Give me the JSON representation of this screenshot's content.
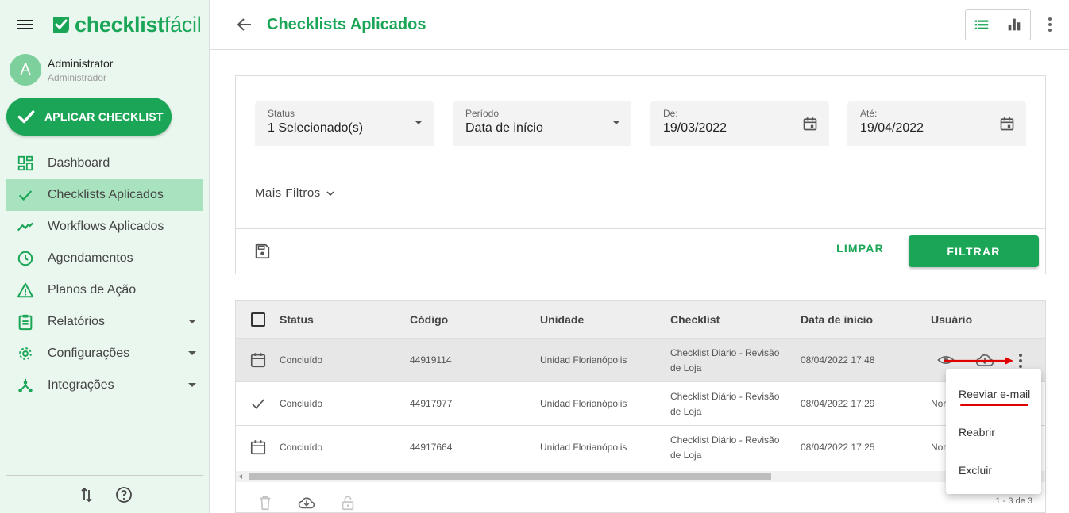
{
  "brand": {
    "logo_bold": "checklist",
    "logo_light": "fácil",
    "accent_color": "#1aa656"
  },
  "user": {
    "initial": "A",
    "name": "Administrator",
    "role": "Administrador"
  },
  "sidebar": {
    "apply_button": "APLICAR CHECKLIST",
    "items": [
      {
        "label": "Dashboard",
        "icon": "dashboard-icon"
      },
      {
        "label": "Checklists Aplicados",
        "icon": "check-icon",
        "active": true
      },
      {
        "label": "Workflows Aplicados",
        "icon": "trending-icon"
      },
      {
        "label": "Agendamentos",
        "icon": "clock-icon"
      },
      {
        "label": "Planos de Ação",
        "icon": "warning-icon"
      },
      {
        "label": "Relatórios",
        "icon": "clipboard-icon",
        "expandable": true
      },
      {
        "label": "Configurações",
        "icon": "gear-icon",
        "expandable": true
      },
      {
        "label": "Integrações",
        "icon": "integration-icon",
        "expandable": true
      }
    ],
    "footer_icons": [
      "sort-arrows-icon",
      "help-icon"
    ]
  },
  "header": {
    "title": "Checklists Aplicados",
    "view_icons": [
      "list-view-icon",
      "chart-view-icon"
    ]
  },
  "filters": {
    "status": {
      "label": "Status",
      "value": "1 Selecionado(s)"
    },
    "period": {
      "label": "Período",
      "value": "Data de início"
    },
    "from": {
      "label": "De:",
      "value": "19/03/2022"
    },
    "to": {
      "label": "Até:",
      "value": "19/04/2022"
    },
    "more": "Mais Filtros",
    "clear": "LIMPAR",
    "apply": "FILTRAR"
  },
  "table": {
    "columns": [
      "Status",
      "Código",
      "Unidade",
      "Checklist",
      "Data de início",
      "Usuário"
    ],
    "rows": [
      {
        "status_icon": "calendar-icon",
        "status": "Concluído",
        "code": "44919114",
        "unit": "Unidad Florianópolis",
        "checklist_l1": "Checklist Diário - Revisão",
        "checklist_l2": "de Loja",
        "start": "08/04/2022 17:48",
        "user": ""
      },
      {
        "status_icon": "check-icon",
        "status": "Concluído",
        "code": "44917977",
        "unit": "Unidad Florianópolis",
        "checklist_l1": "Checklist Diário - Revisão",
        "checklist_l2": "de Loja",
        "start": "08/04/2022 17:29",
        "user": "Nor"
      },
      {
        "status_icon": "calendar-icon",
        "status": "Concluído",
        "code": "44917664",
        "unit": "Unidad Florianópolis",
        "checklist_l1": "Checklist Diário - Revisão",
        "checklist_l2": "de Loja",
        "start": "08/04/2022 17:25",
        "user": "Nor"
      }
    ],
    "pagination": "1 - 3 de 3"
  },
  "context_menu": {
    "items": [
      "Reeviar e-mail",
      "Reabrir",
      "Excluir"
    ]
  },
  "annotation_colors": {
    "arrow": "#e00000",
    "underline": "#e00000"
  }
}
